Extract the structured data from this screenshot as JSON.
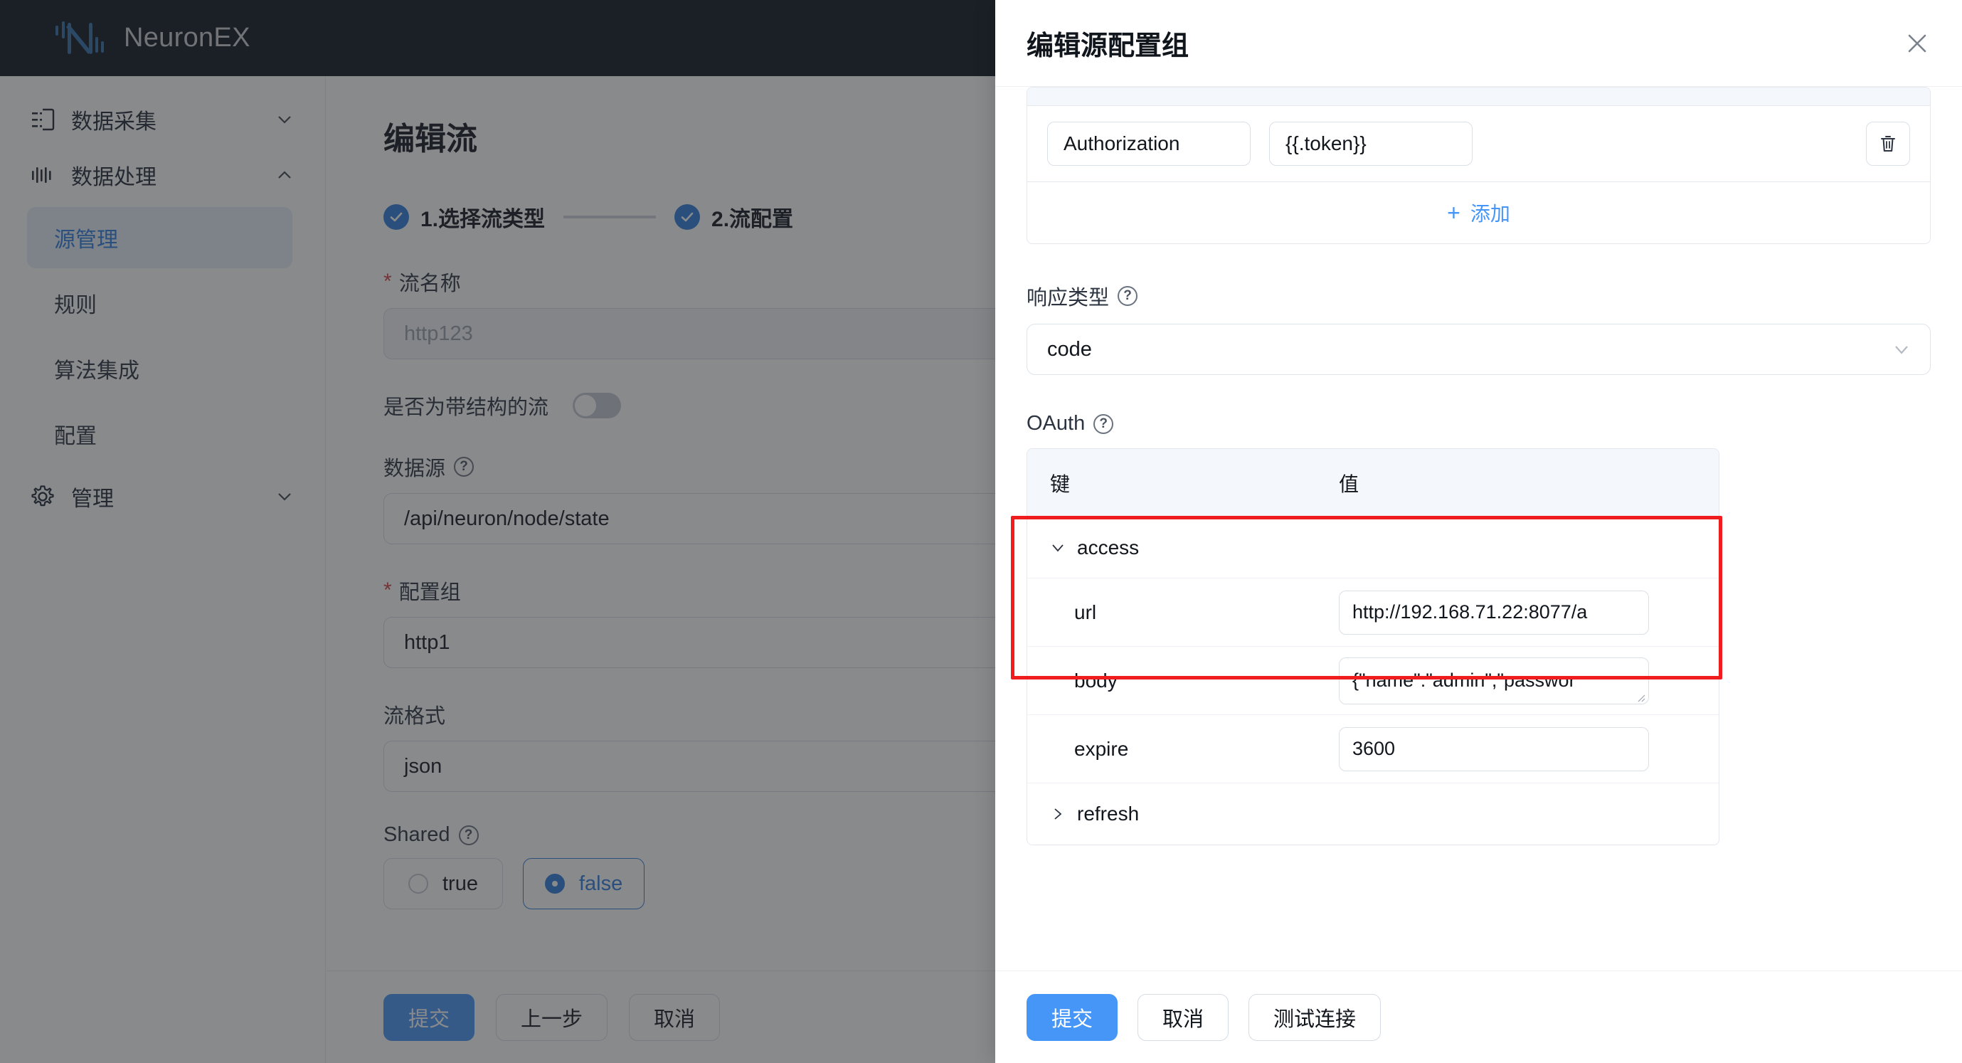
{
  "app": {
    "brand": "NeuronEX",
    "logo_icon": "neuron-logo-icon"
  },
  "sidebar": {
    "groups": [
      {
        "label": "数据采集",
        "icon": "data-collection-icon",
        "chevron": "chevron-down-icon",
        "expanded": false,
        "items": []
      },
      {
        "label": "数据处理",
        "icon": "data-processing-icon",
        "chevron": "chevron-up-icon",
        "expanded": true,
        "items": [
          {
            "label": "源管理",
            "active": true
          },
          {
            "label": "规则",
            "active": false
          },
          {
            "label": "算法集成",
            "active": false
          },
          {
            "label": "配置",
            "active": false
          }
        ]
      },
      {
        "label": "管理",
        "icon": "gear-icon",
        "chevron": "chevron-down-icon",
        "expanded": false,
        "items": []
      }
    ]
  },
  "main": {
    "title": "编辑流",
    "steps": [
      {
        "index": "1",
        "label": "1.选择流类型",
        "done": true
      },
      {
        "index": "2",
        "label": "2.流配置",
        "done": true
      }
    ],
    "fields": {
      "stream_name": {
        "label": "流名称",
        "required": true,
        "value": "http123",
        "disabled": true
      },
      "structured": {
        "label": "是否为带结构的流",
        "on": false
      },
      "datasource": {
        "label": "数据源",
        "help": true,
        "value": "/api/neuron/node/state"
      },
      "config_group": {
        "label": "配置组",
        "required": true,
        "value": "http1"
      },
      "stream_format": {
        "label": "流格式",
        "value": "json"
      },
      "shared": {
        "label": "Shared",
        "help": true,
        "options": [
          {
            "label": "true",
            "selected": false
          },
          {
            "label": "false",
            "selected": true
          }
        ]
      }
    },
    "footer_buttons": [
      {
        "label": "提交",
        "variant": "primary"
      },
      {
        "label": "上一步",
        "variant": "default"
      },
      {
        "label": "取消",
        "variant": "default"
      }
    ]
  },
  "drawer": {
    "title": "编辑源配置组",
    "close_icon": "close-icon",
    "headers_table": {
      "rows": [
        {
          "key": "Authorization",
          "value": "{{.token}}",
          "delete_icon": "trash-icon"
        }
      ],
      "add_label": "添加",
      "add_icon": "plus-icon"
    },
    "response_type": {
      "label": "响应类型",
      "help": true,
      "value": "code",
      "chevron": "chevron-down-icon"
    },
    "oauth": {
      "label": "OAuth",
      "help": true,
      "columns": {
        "key": "键",
        "value": "值"
      },
      "groups": [
        {
          "name": "access",
          "expanded": true,
          "chevron": "chevron-down-icon",
          "rows": [
            {
              "key": "url",
              "value": "http://192.168.71.22:8077/a",
              "type": "input"
            },
            {
              "key": "body",
              "value": "{\"name\":\"admin\",\"passwor",
              "type": "textarea"
            },
            {
              "key": "expire",
              "value": "3600",
              "type": "input"
            }
          ]
        },
        {
          "name": "refresh",
          "expanded": false,
          "chevron": "chevron-right-icon",
          "rows": []
        }
      ]
    },
    "footer_buttons": [
      {
        "label": "提交",
        "variant": "primary"
      },
      {
        "label": "取消",
        "variant": "default"
      },
      {
        "label": "测试连接",
        "variant": "default"
      }
    ]
  },
  "annotation": {
    "highlight_color": "#ef1d1d",
    "target": "oauth-access-group"
  },
  "colors": {
    "accent": "#4596f7",
    "accent_dark": "#2d7ddb",
    "topbar_bg": "#0d1420",
    "sidebar_active_bg": "#e6f0fb",
    "required_star": "#d1434a",
    "table_header_bg": "#f4f8fc"
  }
}
